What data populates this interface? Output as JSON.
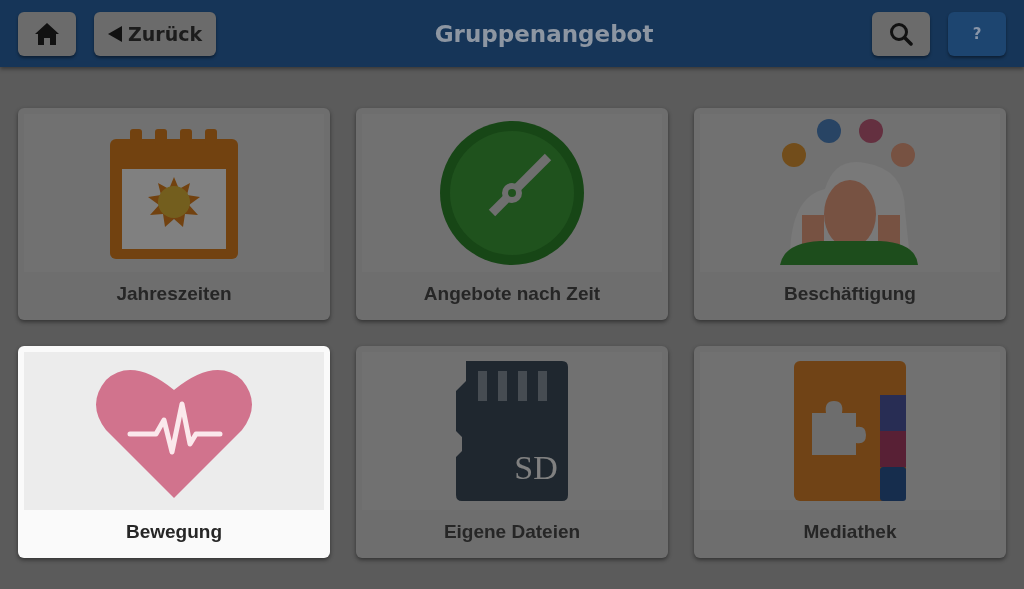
{
  "header": {
    "title": "Gruppenangebot",
    "back_label": "Zurück",
    "help_label": "?"
  },
  "tiles": [
    {
      "label": "Jahreszeiten",
      "kind": "calendar",
      "selected": false
    },
    {
      "label": "Angebote nach Zeit",
      "kind": "clock",
      "selected": false
    },
    {
      "label": "Beschäftigung",
      "kind": "people",
      "selected": false
    },
    {
      "label": "Bewegung",
      "kind": "heart",
      "selected": true
    },
    {
      "label": "Eigene Dateien",
      "kind": "sdcard",
      "selected": false,
      "icon_text": "SD"
    },
    {
      "label": "Mediathek",
      "kind": "book",
      "selected": false
    }
  ]
}
